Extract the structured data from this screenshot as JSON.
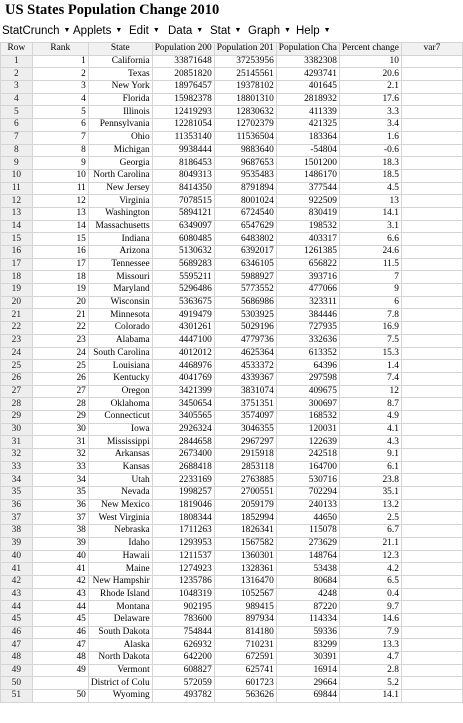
{
  "app": {
    "title": "US States Population Change 2010"
  },
  "menu": [
    {
      "label": "StatCrunch",
      "has_dropdown": true
    },
    {
      "label": "Applets",
      "has_dropdown": true
    },
    {
      "label": "Edit",
      "has_dropdown": true
    },
    {
      "label": "Data",
      "has_dropdown": true
    },
    {
      "label": "Stat",
      "has_dropdown": true
    },
    {
      "label": "Graph",
      "has_dropdown": true
    },
    {
      "label": "Help",
      "has_dropdown": true
    }
  ],
  "grid": {
    "columns": [
      "Row",
      "Rank",
      "State",
      "Population 200",
      "Population 201",
      "Population Cha",
      "Percent change",
      "var7"
    ],
    "rows": [
      [
        "1",
        "1",
        "California",
        "33871648",
        "37253956",
        "3382308",
        "10",
        ""
      ],
      [
        "2",
        "2",
        "Texas",
        "20851820",
        "25145561",
        "4293741",
        "20.6",
        ""
      ],
      [
        "3",
        "3",
        "New York",
        "18976457",
        "19378102",
        "401645",
        "2.1",
        ""
      ],
      [
        "4",
        "4",
        "Florida",
        "15982378",
        "18801310",
        "2818932",
        "17.6",
        ""
      ],
      [
        "5",
        "5",
        "Illinois",
        "12419293",
        "12830632",
        "411339",
        "3.3",
        ""
      ],
      [
        "6",
        "6",
        "Pennsylvania",
        "12281054",
        "12702379",
        "421325",
        "3.4",
        ""
      ],
      [
        "7",
        "7",
        "Ohio",
        "11353140",
        "11536504",
        "183364",
        "1.6",
        ""
      ],
      [
        "8",
        "8",
        "Michigan",
        "9938444",
        "9883640",
        "-54804",
        "-0.6",
        ""
      ],
      [
        "9",
        "9",
        "Georgia",
        "8186453",
        "9687653",
        "1501200",
        "18.3",
        ""
      ],
      [
        "10",
        "10",
        "North Carolina",
        "8049313",
        "9535483",
        "1486170",
        "18.5",
        ""
      ],
      [
        "11",
        "11",
        "New Jersey",
        "8414350",
        "8791894",
        "377544",
        "4.5",
        ""
      ],
      [
        "12",
        "12",
        "Virginia",
        "7078515",
        "8001024",
        "922509",
        "13",
        ""
      ],
      [
        "13",
        "13",
        "Washington",
        "5894121",
        "6724540",
        "830419",
        "14.1",
        ""
      ],
      [
        "14",
        "14",
        "Massachusetts",
        "6349097",
        "6547629",
        "198532",
        "3.1",
        ""
      ],
      [
        "15",
        "15",
        "Indiana",
        "6080485",
        "6483802",
        "403317",
        "6.6",
        ""
      ],
      [
        "16",
        "16",
        "Arizona",
        "5130632",
        "6392017",
        "1261385",
        "24.6",
        ""
      ],
      [
        "17",
        "17",
        "Tennessee",
        "5689283",
        "6346105",
        "656822",
        "11.5",
        ""
      ],
      [
        "18",
        "18",
        "Missouri",
        "5595211",
        "5988927",
        "393716",
        "7",
        ""
      ],
      [
        "19",
        "19",
        "Maryland",
        "5296486",
        "5773552",
        "477066",
        "9",
        ""
      ],
      [
        "20",
        "20",
        "Wisconsin",
        "5363675",
        "5686986",
        "323311",
        "6",
        ""
      ],
      [
        "21",
        "21",
        "Minnesota",
        "4919479",
        "5303925",
        "384446",
        "7.8",
        ""
      ],
      [
        "22",
        "22",
        "Colorado",
        "4301261",
        "5029196",
        "727935",
        "16.9",
        ""
      ],
      [
        "23",
        "23",
        "Alabama",
        "4447100",
        "4779736",
        "332636",
        "7.5",
        ""
      ],
      [
        "24",
        "24",
        "South Carolina",
        "4012012",
        "4625364",
        "613352",
        "15.3",
        ""
      ],
      [
        "25",
        "25",
        "Louisiana",
        "4468976",
        "4533372",
        "64396",
        "1.4",
        ""
      ],
      [
        "26",
        "26",
        "Kentucky",
        "4041769",
        "4339367",
        "297598",
        "7.4",
        ""
      ],
      [
        "27",
        "27",
        "Oregon",
        "3421399",
        "3831074",
        "409675",
        "12",
        ""
      ],
      [
        "28",
        "28",
        "Oklahoma",
        "3450654",
        "3751351",
        "300697",
        "8.7",
        ""
      ],
      [
        "29",
        "29",
        "Connecticut",
        "3405565",
        "3574097",
        "168532",
        "4.9",
        ""
      ],
      [
        "30",
        "30",
        "Iowa",
        "2926324",
        "3046355",
        "120031",
        "4.1",
        ""
      ],
      [
        "31",
        "31",
        "Mississippi",
        "2844658",
        "2967297",
        "122639",
        "4.3",
        ""
      ],
      [
        "32",
        "32",
        "Arkansas",
        "2673400",
        "2915918",
        "242518",
        "9.1",
        ""
      ],
      [
        "33",
        "33",
        "Kansas",
        "2688418",
        "2853118",
        "164700",
        "6.1",
        ""
      ],
      [
        "34",
        "34",
        "Utah",
        "2233169",
        "2763885",
        "530716",
        "23.8",
        ""
      ],
      [
        "35",
        "35",
        "Nevada",
        "1998257",
        "2700551",
        "702294",
        "35.1",
        ""
      ],
      [
        "36",
        "36",
        "New Mexico",
        "1819046",
        "2059179",
        "240133",
        "13.2",
        ""
      ],
      [
        "37",
        "37",
        "West Virginia",
        "1808344",
        "1852994",
        "44650",
        "2.5",
        ""
      ],
      [
        "38",
        "38",
        "Nebraska",
        "1711263",
        "1826341",
        "115078",
        "6.7",
        ""
      ],
      [
        "39",
        "39",
        "Idaho",
        "1293953",
        "1567582",
        "273629",
        "21.1",
        ""
      ],
      [
        "40",
        "40",
        "Hawaii",
        "1211537",
        "1360301",
        "148764",
        "12.3",
        ""
      ],
      [
        "41",
        "41",
        "Maine",
        "1274923",
        "1328361",
        "53438",
        "4.2",
        ""
      ],
      [
        "42",
        "42",
        "New Hampshir",
        "1235786",
        "1316470",
        "80684",
        "6.5",
        ""
      ],
      [
        "43",
        "43",
        "Rhode Island",
        "1048319",
        "1052567",
        "4248",
        "0.4",
        ""
      ],
      [
        "44",
        "44",
        "Montana",
        "902195",
        "989415",
        "87220",
        "9.7",
        ""
      ],
      [
        "45",
        "45",
        "Delaware",
        "783600",
        "897934",
        "114334",
        "14.6",
        ""
      ],
      [
        "46",
        "46",
        "South Dakota",
        "754844",
        "814180",
        "59336",
        "7.9",
        ""
      ],
      [
        "47",
        "47",
        "Alaska",
        "626932",
        "710231",
        "83299",
        "13.3",
        ""
      ],
      [
        "48",
        "48",
        "North Dakota",
        "642200",
        "672591",
        "30391",
        "4.7",
        ""
      ],
      [
        "49",
        "49",
        "Vermont",
        "608827",
        "625741",
        "16914",
        "2.8",
        ""
      ],
      [
        "50",
        "",
        "District of Colu",
        "572059",
        "601723",
        "29664",
        "5.2",
        ""
      ],
      [
        "51",
        "50",
        "Wyoming",
        "493782",
        "563626",
        "69844",
        "14.1",
        ""
      ]
    ]
  }
}
